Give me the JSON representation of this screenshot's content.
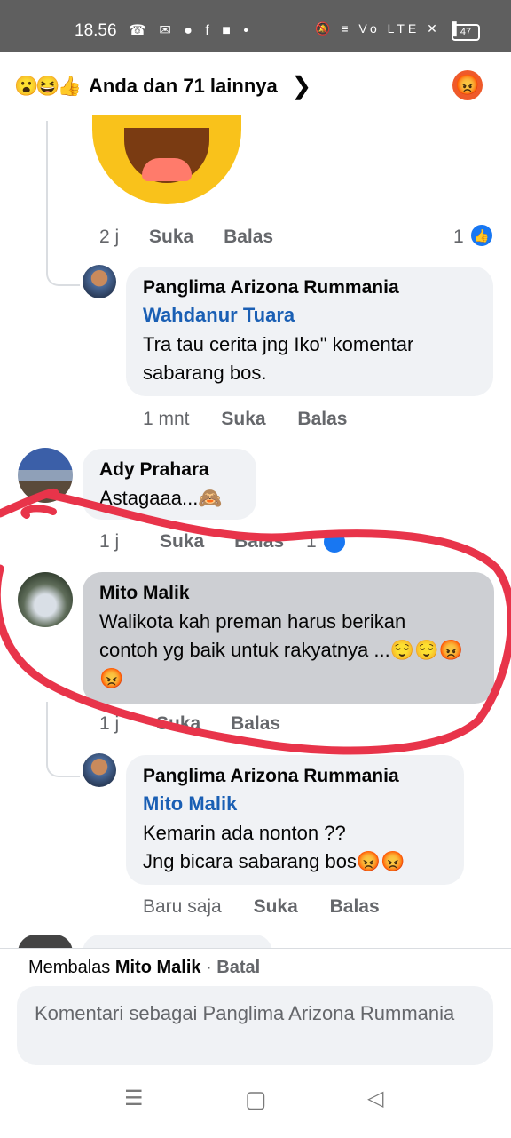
{
  "status_bar": {
    "time": "18.56",
    "app_icons": "☎ ✉ ● f ■ •",
    "system_icons": "🔕 ≡ Vo LTE ✕ ▐",
    "battery": "47"
  },
  "reactions_header": {
    "emojis": "😮😆👍",
    "summary": "Anda dan 71 lainnya",
    "chevron": "❯",
    "my_reaction": "😡"
  },
  "comments": [
    {
      "time": "2 j",
      "like": "Suka",
      "reply": "Balas",
      "like_count": "1",
      "like_icon": "👍"
    },
    {
      "author": "Panglima Arizona Rummania",
      "mention": "Wahdanur Tuara",
      "text": "Tra tau cerita jng Iko\" komentar sabarang bos.",
      "time": "1 mnt",
      "like": "Suka",
      "reply": "Balas"
    },
    {
      "author": "Ady Prahara",
      "text": "Astagaaa...🙈",
      "time": "1 j",
      "like": "Suka",
      "reply": "Balas",
      "like_count": "1"
    },
    {
      "author": "Mito Malik",
      "text": "Walikota kah preman harus berikan contoh yg baik untuk rakyatnya ...😌😌😡😡",
      "time": "1 j",
      "like": "Suka",
      "reply": "Balas"
    },
    {
      "author": "Panglima Arizona Rummania",
      "mention": "Mito Malik",
      "text_line1": "Kemarin ada nonton ??",
      "text_line2": "Jng bicara sabarang bos😡😡",
      "time": "Baru saja",
      "like": "Suka",
      "reply": "Balas"
    }
  ],
  "composer": {
    "replying_prefix": "Membalas",
    "replying_to": "Mito Malik",
    "separator": "·",
    "cancel": "Batal",
    "placeholder": "Komentari sebagai Panglima Arizona Rummania"
  },
  "nav": {
    "menu": "☰",
    "home": "▢",
    "back": "◁"
  },
  "annotation_color": "#e8344a"
}
